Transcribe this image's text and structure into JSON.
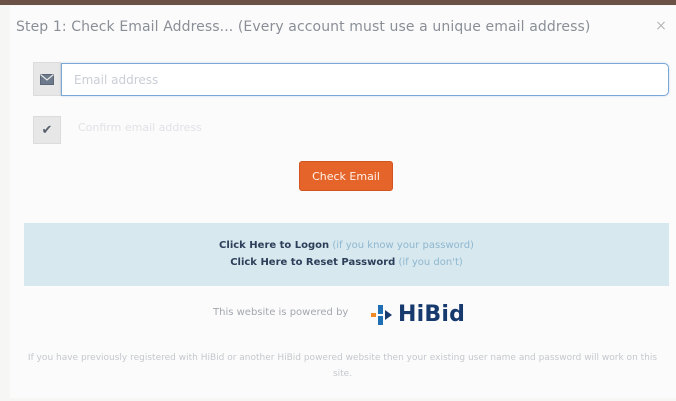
{
  "dialog": {
    "title": "Step 1: Check Email Address... (Every account must use a unique email address)",
    "close_symbol": "×"
  },
  "email": {
    "icon": "envelope-icon",
    "placeholder": "Email address",
    "value": ""
  },
  "confirm": {
    "icon": "check-icon",
    "text": "Confirm email address"
  },
  "check_button": {
    "label": "Check Email"
  },
  "account_links": {
    "logon_label": "Click Here to Logon",
    "logon_hint": "(if you know your password)",
    "reset_label": "Click Here to Reset Password",
    "reset_hint": "(if you don't)"
  },
  "powered_by": {
    "text": "This website is powered by",
    "logo_text": "HiBid"
  },
  "note": "If you have previously registered with HiBid or another HiBid powered website then your existing user name and password will work on this site.",
  "colors": {
    "accent_button": "#e5642a",
    "info_background": "#d7e8ef",
    "link": "#2d3f58",
    "logo": "#173a6e"
  }
}
